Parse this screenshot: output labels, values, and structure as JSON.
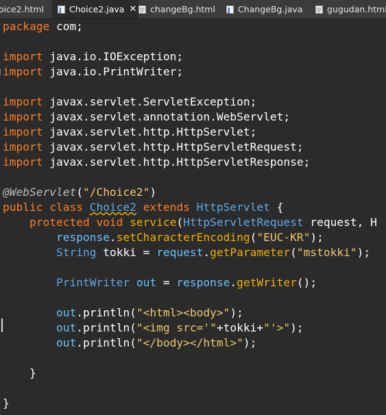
{
  "tabs": [
    {
      "label": "oice2.html",
      "icon": "html-file-icon",
      "active": false
    },
    {
      "label": "Choice2.java",
      "icon": "java-file-icon",
      "active": true,
      "close": "✕"
    },
    {
      "label": "changeBg.html",
      "icon": "html-file-icon",
      "active": false
    },
    {
      "label": "ChangeBg.java",
      "icon": "java-file-icon",
      "active": false
    },
    {
      "label": "gugudan.html",
      "icon": "html-file-icon",
      "active": false
    }
  ],
  "code": {
    "l1": {
      "kw": "package",
      "rest": " com;"
    },
    "l3": {
      "kw": "import",
      "rest": " java.io.IOException;"
    },
    "l4": {
      "kw": "import",
      "rest": " java.io.PrintWriter;"
    },
    "l6": {
      "kw": "import",
      "rest": " javax.servlet.ServletException;"
    },
    "l7": {
      "kw": "import",
      "rest": " javax.servlet.annotation.WebServlet;"
    },
    "l8": {
      "kw": "import",
      "rest": " javax.servlet.http.HttpServlet;"
    },
    "l9": {
      "kw": "import",
      "rest": " javax.servlet.http.HttpServletRequest;"
    },
    "l10": {
      "kw": "import",
      "rest": " javax.servlet.http.HttpServletResponse;"
    },
    "l12": {
      "ann": "@WebServlet",
      "p1": "(",
      "str": "\"/Choice2\"",
      "p2": ")"
    },
    "l13": {
      "kw1": "public class",
      "sp1": " ",
      "cls": "Choice2",
      "sp2": " ",
      "kw2": "extends",
      "sp3": " ",
      "ty": "HttpServlet",
      "p": " {"
    },
    "l14": {
      "ind": "    ",
      "kw1": "protected void",
      "sp1": " ",
      "fn": "service",
      "p1": "(",
      "ty": "HttpServletRequest",
      "rest": " request, H"
    },
    "l15": {
      "ind": "        ",
      "var": "response",
      "p1": ".",
      "fn": "setCharacterEncoding",
      "p2": "(",
      "str": "\"EUC-KR\"",
      "p3": ");"
    },
    "l16": {
      "ind": "        ",
      "ty": "String",
      "sp": " ",
      "v": "tokki",
      "eq": " = ",
      "var": "request",
      "p1": ".",
      "fn": "getParameter",
      "p2": "(",
      "str": "\"mstokki\"",
      "p3": ");"
    },
    "l18": {
      "ind": "        ",
      "ty": "PrintWriter",
      "sp": " ",
      "v": "out",
      "eq": " = ",
      "var": "response",
      "p1": ".",
      "fn": "getWriter",
      "p2": "();"
    },
    "l20": {
      "ind": "        ",
      "var": "out",
      "p1": ".println(",
      "str": "\"<html><body>\"",
      "p2": ");"
    },
    "l21": {
      "ind": "        ",
      "var": "out",
      "p1": ".println(",
      "str1": "\"<img src='\"",
      "mid": "+tokki+",
      "str2": "\"'>\"",
      "p2": ");"
    },
    "l22": {
      "ind": "        ",
      "var": "out",
      "p1": ".println(",
      "str": "\"</body></html>\"",
      "p2": ");"
    },
    "l24": {
      "text": "    }"
    },
    "l26": {
      "text": "}"
    }
  },
  "colors": {
    "background": "#2b2b2b",
    "keyword": "#ff7f24",
    "type": "#5fa8e6",
    "method": "#f0b000",
    "string": "#f0c870"
  }
}
